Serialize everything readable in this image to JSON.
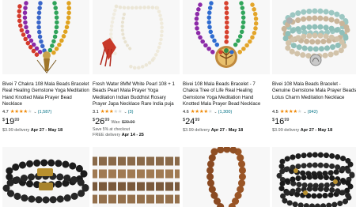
{
  "products": [
    {
      "title": "Bivei 7 Chakra 108 Mala Beads Bracelet Real Healing Gemstone Yoga Meditation Hand Knotted Mala Prayer Bead Necklace",
      "rating": "4.7",
      "stars": 4.5,
      "review_count": "(1,587)",
      "currency": "$",
      "price_whole": "19",
      "price_fraction": "99",
      "delivery_prefix": "$3.99 delivery",
      "delivery_date": "Apr 27 - May 18",
      "image_icon": "chakra-mala-necklace-image"
    },
    {
      "title": "Fresh Water 8MM White Pearl 108 + 1 Beads Pearl Mala Prayer Yoga Meditation Indian Buddhist Rosary Prayer Japa Necklace Rare India puja",
      "rating": "3.1",
      "stars": 3,
      "review_count": "(3)",
      "currency": "$",
      "price_whole": "26",
      "price_fraction": "99",
      "was_label": "Was:",
      "was_price": "$29.99",
      "save_text": "Save 5% at checkout",
      "delivery_prefix": "FREE delivery",
      "delivery_date": "Apr 14 - 25",
      "image_icon": "pearl-mala-necklace-image"
    },
    {
      "title": "Bivei 108 Mala Beads Bracelet - 7 Chakra Tree of Life Real Healing Gemstone Yoga Meditation Hand Knotted Mala Prayer Bead Necklace",
      "rating": "4.6",
      "stars": 4.5,
      "review_count": "(1,300)",
      "currency": "$",
      "price_whole": "24",
      "price_fraction": "99",
      "delivery_prefix": "$3.99 delivery",
      "delivery_date": "Apr 27 - May 18",
      "image_icon": "tree-of-life-mala-image"
    },
    {
      "title": "Bivei 108 Mala Beads Bracelet - Genuine Gemstone Mala Prayer Beads Lotus Charm Meditation Necklace",
      "rating": "4.5",
      "stars": 4.5,
      "review_count": "(942)",
      "currency": "$",
      "price_whole": "16",
      "price_fraction": "99",
      "delivery_prefix": "$3.99 delivery",
      "delivery_date": "Apr 27 - May 18",
      "image_icon": "amazonite-wrap-bracelet-image"
    }
  ],
  "second_row": [
    {
      "image_icon": "black-bead-bracelets-image"
    },
    {
      "image_icon": "agate-bead-strand-image"
    },
    {
      "image_icon": "rudraksha-bead-bracelet-image"
    },
    {
      "image_icon": "dark-bead-mala-image"
    }
  ],
  "colors": {
    "star": "#f08804",
    "link": "#007185",
    "text": "#0f1111",
    "muted": "#565959",
    "image_bg": "#f7f7f7"
  }
}
